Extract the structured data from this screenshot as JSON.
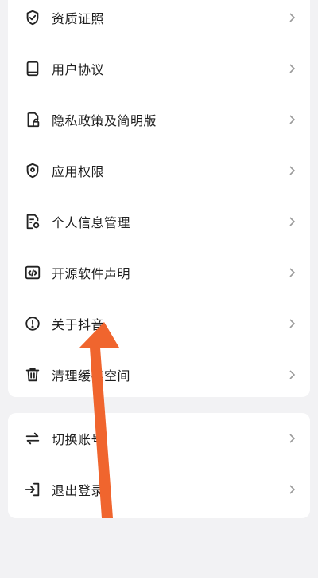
{
  "settings": {
    "items": [
      {
        "label": "资质证照",
        "icon": "shield-check-icon"
      },
      {
        "label": "用户协议",
        "icon": "book-icon"
      },
      {
        "label": "隐私政策及简明版",
        "icon": "document-lock-icon"
      },
      {
        "label": "应用权限",
        "icon": "shield-location-icon"
      },
      {
        "label": "个人信息管理",
        "icon": "document-gear-icon"
      },
      {
        "label": "开源软件声明",
        "icon": "code-icon"
      },
      {
        "label": "关于抖音",
        "icon": "info-circle-icon"
      },
      {
        "label": "清理缓存空间",
        "icon": "trash-icon"
      }
    ],
    "account_items": [
      {
        "label": "切换账号",
        "icon": "switch-arrows-icon"
      },
      {
        "label": "退出登录",
        "icon": "logout-icon"
      }
    ]
  },
  "colors": {
    "background": "#f2f2f4",
    "card": "#ffffff",
    "text": "#1f1f1f",
    "chevron": "#9a9a9a",
    "annotation_arrow": "#f0652e"
  }
}
